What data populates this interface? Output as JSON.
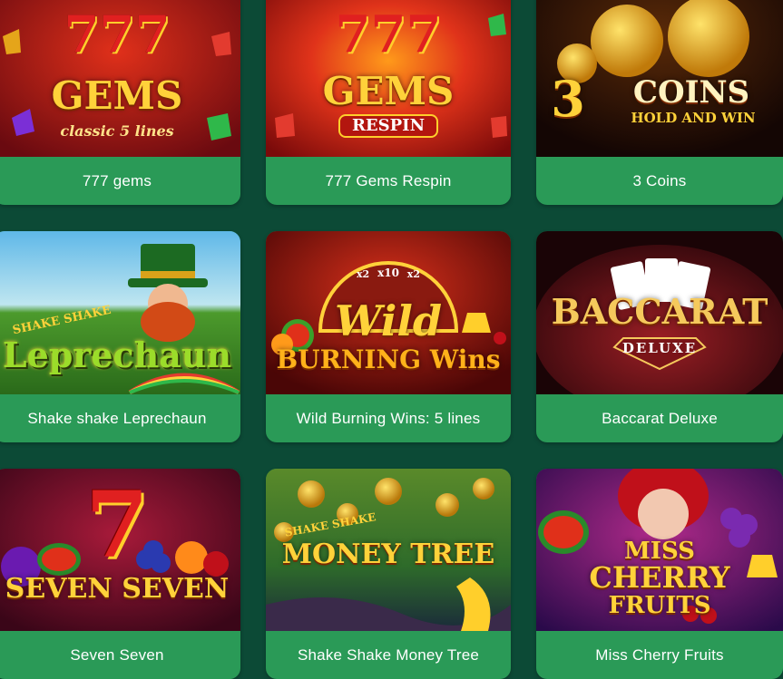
{
  "games": [
    {
      "title": "777 gems",
      "art": {
        "line1": "777",
        "line2": "GEMS",
        "line3": "classic 5 lines"
      },
      "colors": {
        "bg": "#8a0f14",
        "accent": "#ffcf2b"
      }
    },
    {
      "title": "777 Gems Respin",
      "art": {
        "line1": "777",
        "line2": "GEMS",
        "line3": "RESPIN"
      },
      "colors": {
        "bg": "#b3160f",
        "accent": "#ffcf2b"
      }
    },
    {
      "title": "3 Coins",
      "art": {
        "line1": "3",
        "line2": "COINS",
        "line3": "HOLD AND WIN"
      },
      "colors": {
        "bg": "#1a0a04",
        "accent": "#f3b21e"
      }
    },
    {
      "title": "Shake shake Leprechaun",
      "art": {
        "line1": "SHAKE SHAKE",
        "line2": "Leprechaun"
      },
      "colors": {
        "bg": "#3d9a2f",
        "accent": "#9bdc2a"
      }
    },
    {
      "title": "Wild Burning Wins: 5 lines",
      "art": {
        "line1": "Wild",
        "line2": "BURNING Wins",
        "wheel": [
          "x2",
          "x10",
          "x2"
        ]
      },
      "colors": {
        "bg": "#7a0a0a",
        "accent": "#ffd23a"
      }
    },
    {
      "title": "Baccarat Deluxe",
      "art": {
        "line1": "BACCARAT",
        "line2": "DELUXE"
      },
      "colors": {
        "bg": "#3a0c10",
        "accent": "#f5c95c"
      }
    },
    {
      "title": "Seven Seven",
      "art": {
        "line1": "7",
        "line2": "SEVEN SEVEN"
      },
      "colors": {
        "bg": "#5a0e2a",
        "accent": "#ffd23a"
      }
    },
    {
      "title": "Shake Shake Money Tree",
      "art": {
        "line1": "SHAKE SHAKE",
        "line2": "MONEY TREE"
      },
      "colors": {
        "bg": "#2e6b2a",
        "accent": "#ffd23a"
      }
    },
    {
      "title": "Miss Cherry Fruits",
      "art": {
        "line1": "MISS",
        "line2": "CHERRY",
        "line3": "FRUITS"
      },
      "colors": {
        "bg": "#3b1366",
        "accent": "#ffd23a"
      }
    }
  ]
}
